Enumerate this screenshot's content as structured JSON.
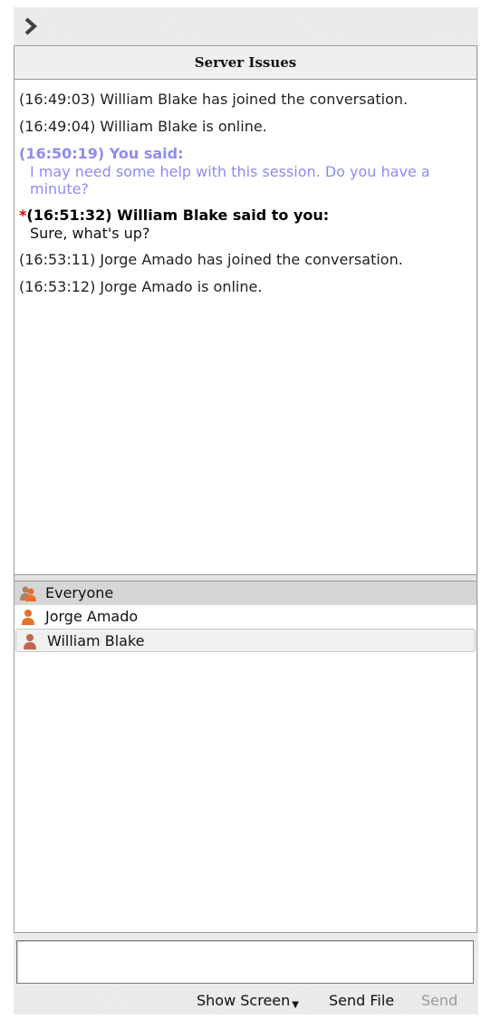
{
  "conversation": {
    "title": "Server Issues"
  },
  "messages": {
    "m1": "(16:49:03) William Blake has joined the conversation.",
    "m2": "(16:49:04) William Blake is online.",
    "m3_head": "(16:50:19) You said:",
    "m3_body": "I may need some help with this session. Do you have a minute?",
    "m4_star": "*",
    "m4_head": "(16:51:32) William Blake said to you:",
    "m4_body": "Sure, what's up?",
    "m5": "(16:53:11) Jorge Amado has joined the conversation.",
    "m6": "(16:53:12) Jorge Amado is online."
  },
  "participants": {
    "everyone": "Everyone",
    "p1": "Jorge Amado",
    "p2": "William Blake"
  },
  "input": {
    "value": ""
  },
  "actions": {
    "show_screen": "Show Screen",
    "send_file": "Send File",
    "send": "Send"
  },
  "icons": {
    "collapse": "chevron-right-icon",
    "everyone": "group-user-icon",
    "user": "user-icon"
  },
  "colors": {
    "self_message": "#8c8cf0",
    "unread_marker": "#e00000",
    "user_icon": "#e8702a"
  }
}
